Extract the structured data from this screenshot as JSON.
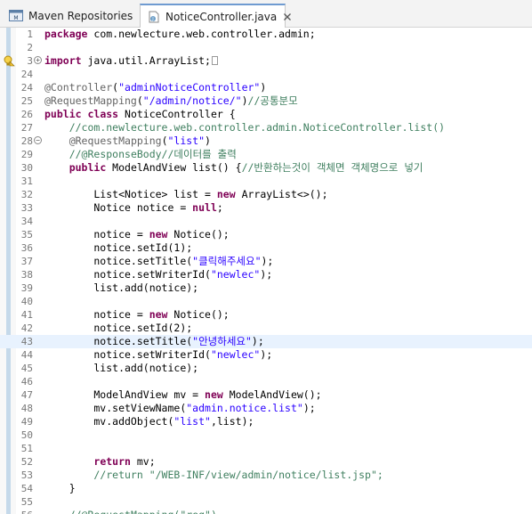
{
  "tabs": [
    {
      "label": "Maven Repositories",
      "icon": "maven-repositories-icon",
      "active": false
    },
    {
      "label": "NoticeController.java",
      "icon": "java-file-icon",
      "active": true
    }
  ],
  "editor": {
    "current_line": "43",
    "lines": [
      {
        "n": "1",
        "tokens": [
          [
            "kw",
            "package"
          ],
          [
            "ph",
            " com.newlecture.web.controller.admin;"
          ]
        ]
      },
      {
        "n": "2",
        "tokens": []
      },
      {
        "n": "3",
        "fold": "+",
        "marker": "lightbulb-warning",
        "tokens": [
          [
            "kw",
            "import"
          ],
          [
            "ph",
            " java.util.ArrayList;"
          ]
        ]
      },
      {
        "n": "24",
        "tokens": []
      },
      {
        "n": "24",
        "tokens": [
          [
            "ann",
            "@Controller"
          ],
          [
            "ph",
            "("
          ],
          [
            "str",
            "\"adminNoticeController\""
          ],
          [
            "ph",
            ")"
          ]
        ]
      },
      {
        "n": "25",
        "tokens": [
          [
            "ann",
            "@RequestMapping"
          ],
          [
            "ph",
            "("
          ],
          [
            "str",
            "\"/admin/notice/\""
          ],
          [
            "ph",
            ")"
          ],
          [
            "cmt",
            "//공통분모"
          ]
        ]
      },
      {
        "n": "26",
        "tokens": [
          [
            "kw",
            "public"
          ],
          [
            "ph",
            " "
          ],
          [
            "kw",
            "class"
          ],
          [
            "ph",
            " NoticeController {"
          ]
        ]
      },
      {
        "n": "27",
        "tokens": [
          [
            "ph",
            "    "
          ],
          [
            "cmt",
            "//com.newlecture.web.controller.admin.NoticeController.list()"
          ]
        ]
      },
      {
        "n": "28",
        "fold": "−",
        "tokens": [
          [
            "ph",
            "    "
          ],
          [
            "ann",
            "@RequestMapping"
          ],
          [
            "ph",
            "("
          ],
          [
            "str",
            "\"list\""
          ],
          [
            "ph",
            ")"
          ]
        ]
      },
      {
        "n": "29",
        "tokens": [
          [
            "ph",
            "    "
          ],
          [
            "cmt",
            "//@ResponseBody//데이터를 출력"
          ]
        ]
      },
      {
        "n": "30",
        "tokens": [
          [
            "ph",
            "    "
          ],
          [
            "kw",
            "public"
          ],
          [
            "ph",
            " ModelAndView list() {"
          ],
          [
            "cmt",
            "//반환하는것이 객체면 객체명으로 넣기"
          ]
        ]
      },
      {
        "n": "31",
        "tokens": []
      },
      {
        "n": "32",
        "tokens": [
          [
            "ph",
            "        List<Notice> list = "
          ],
          [
            "kw",
            "new"
          ],
          [
            "ph",
            " ArrayList<>();"
          ]
        ]
      },
      {
        "n": "33",
        "tokens": [
          [
            "ph",
            "        Notice notice = "
          ],
          [
            "kw",
            "null"
          ],
          [
            "ph",
            ";"
          ]
        ]
      },
      {
        "n": "34",
        "tokens": []
      },
      {
        "n": "35",
        "tokens": [
          [
            "ph",
            "        notice = "
          ],
          [
            "kw",
            "new"
          ],
          [
            "ph",
            " Notice();"
          ]
        ]
      },
      {
        "n": "36",
        "tokens": [
          [
            "ph",
            "        notice.setId(1);"
          ]
        ]
      },
      {
        "n": "37",
        "tokens": [
          [
            "ph",
            "        notice.setTitle("
          ],
          [
            "str",
            "\"클릭해주세요\""
          ],
          [
            "ph",
            ");"
          ]
        ]
      },
      {
        "n": "38",
        "tokens": [
          [
            "ph",
            "        notice.setWriterId("
          ],
          [
            "str",
            "\"newlec\""
          ],
          [
            "ph",
            ");"
          ]
        ]
      },
      {
        "n": "39",
        "tokens": [
          [
            "ph",
            "        list.add(notice);"
          ]
        ]
      },
      {
        "n": "40",
        "tokens": []
      },
      {
        "n": "41",
        "tokens": [
          [
            "ph",
            "        notice = "
          ],
          [
            "kw",
            "new"
          ],
          [
            "ph",
            " Notice();"
          ]
        ]
      },
      {
        "n": "42",
        "tokens": [
          [
            "ph",
            "        notice.setId(2);"
          ]
        ]
      },
      {
        "n": "43",
        "tokens": [
          [
            "ph",
            "        notice.setTitle("
          ],
          [
            "str",
            "\"안녕하세요\""
          ],
          [
            "ph",
            ");"
          ]
        ]
      },
      {
        "n": "44",
        "tokens": [
          [
            "ph",
            "        notice.setWriterId("
          ],
          [
            "str",
            "\"newlec\""
          ],
          [
            "ph",
            ");"
          ]
        ]
      },
      {
        "n": "45",
        "tokens": [
          [
            "ph",
            "        list.add(notice);"
          ]
        ]
      },
      {
        "n": "46",
        "tokens": []
      },
      {
        "n": "47",
        "tokens": [
          [
            "ph",
            "        ModelAndView mv = "
          ],
          [
            "kw",
            "new"
          ],
          [
            "ph",
            " ModelAndView();"
          ]
        ]
      },
      {
        "n": "48",
        "tokens": [
          [
            "ph",
            "        mv.setViewName("
          ],
          [
            "str",
            "\"admin.notice.list\""
          ],
          [
            "ph",
            ");"
          ]
        ]
      },
      {
        "n": "49",
        "tokens": [
          [
            "ph",
            "        mv.addObject("
          ],
          [
            "str",
            "\"list\""
          ],
          [
            "ph",
            ",list);"
          ]
        ]
      },
      {
        "n": "50",
        "tokens": []
      },
      {
        "n": "51",
        "tokens": []
      },
      {
        "n": "52",
        "tokens": [
          [
            "ph",
            "        "
          ],
          [
            "kw",
            "return"
          ],
          [
            "ph",
            " mv;"
          ]
        ]
      },
      {
        "n": "53",
        "tokens": [
          [
            "ph",
            "        "
          ],
          [
            "cmt",
            "//return \"/WEB-INF/view/admin/notice/list.jsp\";"
          ]
        ]
      },
      {
        "n": "54",
        "tokens": [
          [
            "ph",
            "    }"
          ]
        ]
      },
      {
        "n": "55",
        "tokens": []
      },
      {
        "n": "56",
        "tokens": [
          [
            "ph",
            "    "
          ],
          [
            "cmt",
            "//@RequestMapping(\"reg\")"
          ]
        ]
      }
    ]
  }
}
